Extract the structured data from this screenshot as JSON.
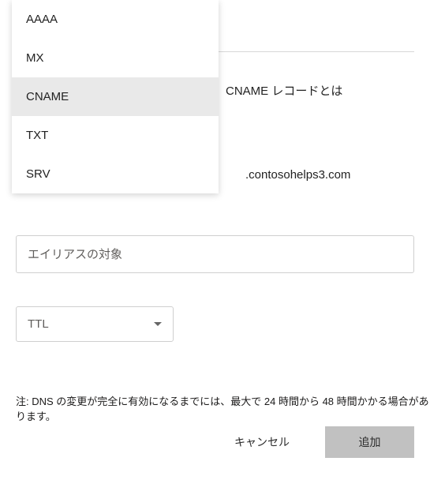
{
  "dropdown": {
    "items": [
      {
        "label": "AAAA",
        "selected": false
      },
      {
        "label": "MX",
        "selected": false
      },
      {
        "label": "CNAME",
        "selected": true
      },
      {
        "label": "TXT",
        "selected": false
      },
      {
        "label": "SRV",
        "selected": false
      }
    ]
  },
  "panel": {
    "hintLabel": "CNAME レコードとは",
    "domainSuffix": ".contosohelps3.com"
  },
  "aliasTarget": {
    "placeholder": "エイリアスの対象"
  },
  "ttl": {
    "placeholder": "TTL"
  },
  "note": "注: DNS の変更が完全に有効になるまでには、最大で 24 時間から 48 時間かかる場合があります。",
  "buttons": {
    "cancel": "キャンセル",
    "add": "追加"
  }
}
